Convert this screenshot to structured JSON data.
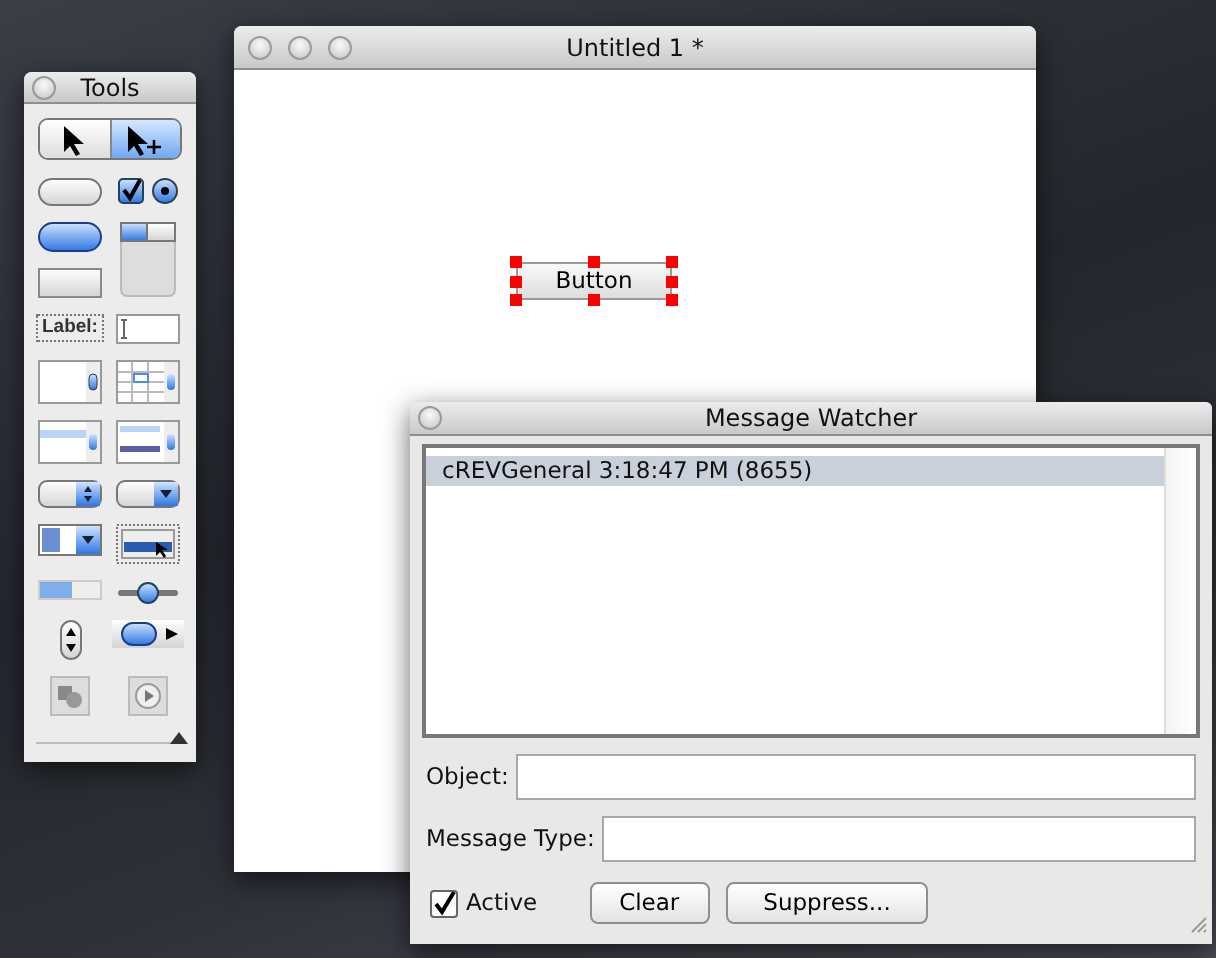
{
  "tools_palette": {
    "title": "Tools",
    "pointer_tools": [
      {
        "kind": "browse",
        "selected": false
      },
      {
        "kind": "edit",
        "selected": true
      }
    ],
    "tools": [
      {
        "kind": "push-button"
      },
      {
        "kind": "checkbox"
      },
      {
        "kind": "radio"
      },
      {
        "kind": "default-button"
      },
      {
        "kind": "tab-panel"
      },
      {
        "kind": "rect-button"
      },
      {
        "kind": "label",
        "label": "Label:"
      },
      {
        "kind": "field"
      },
      {
        "kind": "scrolling-field"
      },
      {
        "kind": "table-field"
      },
      {
        "kind": "list-field"
      },
      {
        "kind": "scrolling-list"
      },
      {
        "kind": "option-menu"
      },
      {
        "kind": "pulldown"
      },
      {
        "kind": "combo-box"
      },
      {
        "kind": "popup-menu"
      },
      {
        "kind": "progress-bar"
      },
      {
        "kind": "slider"
      },
      {
        "kind": "stepper"
      },
      {
        "kind": "scrollbar"
      },
      {
        "kind": "image"
      },
      {
        "kind": "player"
      }
    ]
  },
  "stack_window": {
    "title": "Untitled 1 *",
    "button": {
      "label": "Button",
      "selected": true
    }
  },
  "message_watcher": {
    "title": "Message Watcher",
    "messages": [
      {
        "text": "cREVGeneral 3:18:47 PM (8655)",
        "selected": true
      }
    ],
    "object_label": "Object:",
    "message_type_label": "Message Type:",
    "active": {
      "label": "Active",
      "checked": true
    },
    "buttons": [
      "Clear",
      "Suppress..."
    ]
  }
}
